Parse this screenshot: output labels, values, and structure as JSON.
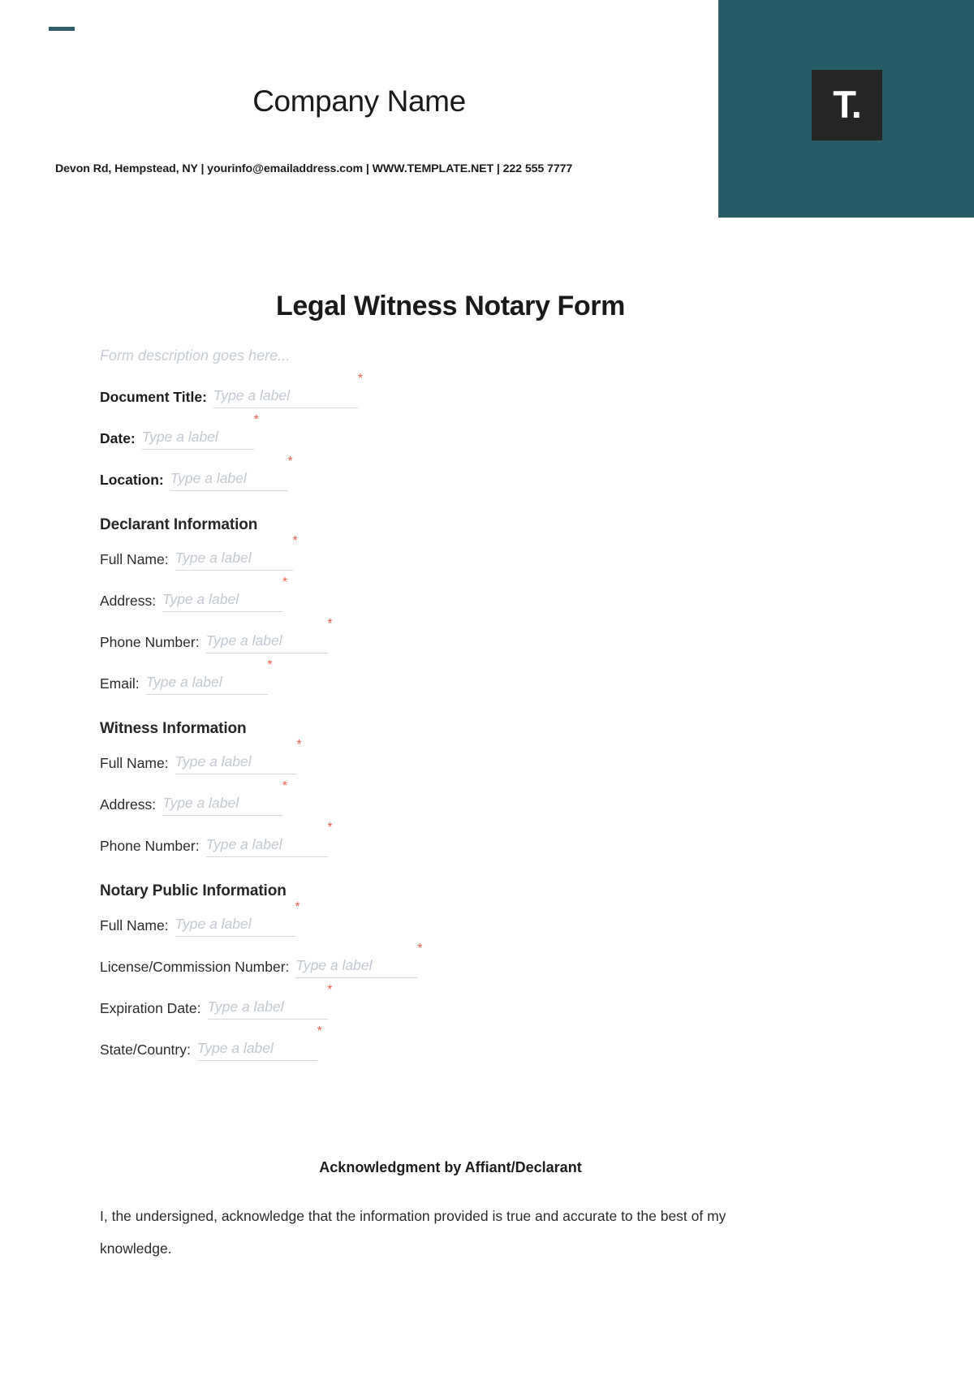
{
  "header": {
    "company_name": "Company Name",
    "contact_line": "Devon Rd, Hempstead, NY | yourinfo@emailaddress.com | WWW.TEMPLATE.NET | 222 555 7777",
    "logo_glyph": "T.",
    "teal_color": "#275c66",
    "logo_tile_color": "#262626",
    "accent_dash_color": "#2f5f69"
  },
  "document": {
    "title": "Legal Witness Notary Form",
    "description": "Form description goes here...",
    "placeholder": "Type a label",
    "required_marker": "*",
    "required_marker_color": "#f25f4e"
  },
  "fields": {
    "document_title": "Document Title:",
    "date": "Date:",
    "location": "Location:",
    "full_name": "Full Name:",
    "address": "Address:",
    "phone_number": "Phone Number:",
    "email": "Email:",
    "license_number": "License/Commission Number:",
    "expiration_date": "Expiration Date:",
    "state_country": "State/Country:"
  },
  "sections": {
    "declarant": "Declarant Information",
    "witness": "Witness Information",
    "notary": "Notary Public Information"
  },
  "acknowledgment": {
    "heading": "Acknowledgment by Affiant/Declarant",
    "body": "I, the undersigned, acknowledge that the information provided is true and accurate to the best of my knowledge."
  }
}
